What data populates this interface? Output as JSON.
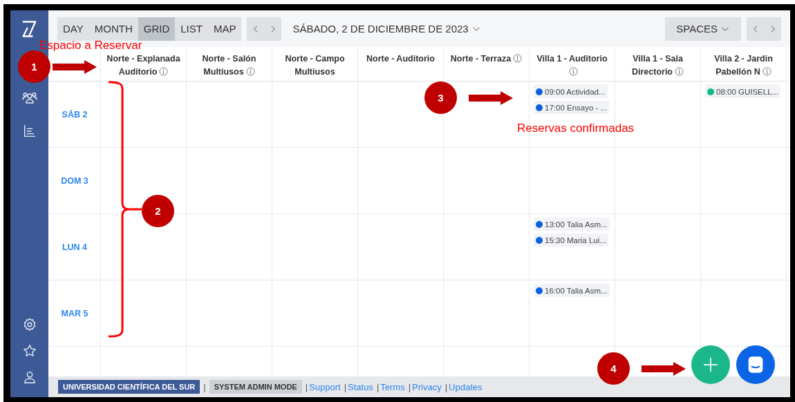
{
  "sidebar": {
    "nav": [
      {
        "kind": "people"
      },
      {
        "kind": "chart"
      }
    ],
    "bottom": [
      {
        "kind": "settings"
      },
      {
        "kind": "star"
      },
      {
        "kind": "user"
      }
    ]
  },
  "toolbar": {
    "views": [
      {
        "label": "DAY",
        "selected": false
      },
      {
        "label": "MONTH",
        "selected": false
      },
      {
        "label": "GRID",
        "selected": true
      },
      {
        "label": "LIST",
        "selected": false
      },
      {
        "label": "MAP",
        "selected": false
      }
    ],
    "date": "SÁBADO, 2 DE DICIEMBRE DE 2023",
    "spaces": "SPACES"
  },
  "columns": [
    {
      "name": "Norte - Explanada Auditorio",
      "info": true
    },
    {
      "name": "Norte - Salón Multiusos",
      "info": true
    },
    {
      "name": "Norte - Campo Multiusos",
      "info": false
    },
    {
      "name": "Norte - Auditorio",
      "info": false
    },
    {
      "name": "Norte - Terraza",
      "info": true
    },
    {
      "name": "Villa 1 - Auditorio",
      "info": true
    },
    {
      "name": "Villa 1 - Sala Directorio",
      "info": true
    },
    {
      "name": "Villa 2 - Jardin Pabellón N",
      "info": true
    }
  ],
  "rows": [
    {
      "day": "SÁB 2",
      "cells": [
        {},
        {},
        {},
        {},
        {},
        {
          "events": [
            {
              "text": "09:00 Actividad...",
              "color": "#0b5fe0"
            },
            {
              "text": "17:00 Ensayo - ...",
              "color": "#0b5fe0"
            }
          ]
        },
        {},
        {
          "events": [
            {
              "text": "08:00 GUISELL...",
              "color": "#12b886"
            }
          ]
        }
      ]
    },
    {
      "day": "DOM 3",
      "cells": [
        {},
        {},
        {},
        {},
        {},
        {},
        {},
        {}
      ]
    },
    {
      "day": "LUN 4",
      "cells": [
        {},
        {},
        {},
        {},
        {},
        {
          "events": [
            {
              "text": "13:00 Talia Asm...",
              "color": "#0b5fe0"
            },
            {
              "text": "15:30 Maria Lui...",
              "color": "#0b5fe0"
            }
          ]
        },
        {},
        {}
      ]
    },
    {
      "day": "MAR 5",
      "cells": [
        {},
        {},
        {},
        {},
        {},
        {
          "events": [
            {
              "text": "16:00 Talia Asm...",
              "color": "#0b5fe0"
            }
          ]
        },
        {},
        {}
      ]
    }
  ],
  "footer": [
    {
      "kind": "org",
      "text": "UNIVERSIDAD CIENTÍFICA DEL SUR"
    },
    {
      "kind": "sep",
      "text": "|"
    },
    {
      "kind": "mode",
      "text": "SYSTEM ADMIN MODE"
    },
    {
      "kind": "sep",
      "text": "|"
    },
    {
      "kind": "link",
      "text": "Support"
    },
    {
      "kind": "sep",
      "text": "|"
    },
    {
      "kind": "link",
      "text": "Status"
    },
    {
      "kind": "sep",
      "text": "|"
    },
    {
      "kind": "link",
      "text": "Terms"
    },
    {
      "kind": "sep",
      "text": "|"
    },
    {
      "kind": "link",
      "text": "Privacy"
    },
    {
      "kind": "sep",
      "text": "|"
    },
    {
      "kind": "link",
      "text": "Updates"
    }
  ],
  "annotations": {
    "labels": [
      {
        "text": "Espacio a Reservar"
      },
      {
        "text": "Reservas confirmadas"
      }
    ],
    "markers": [
      {
        "number": "1"
      },
      {
        "number": "2"
      },
      {
        "number": "3"
      },
      {
        "number": "4"
      }
    ]
  }
}
